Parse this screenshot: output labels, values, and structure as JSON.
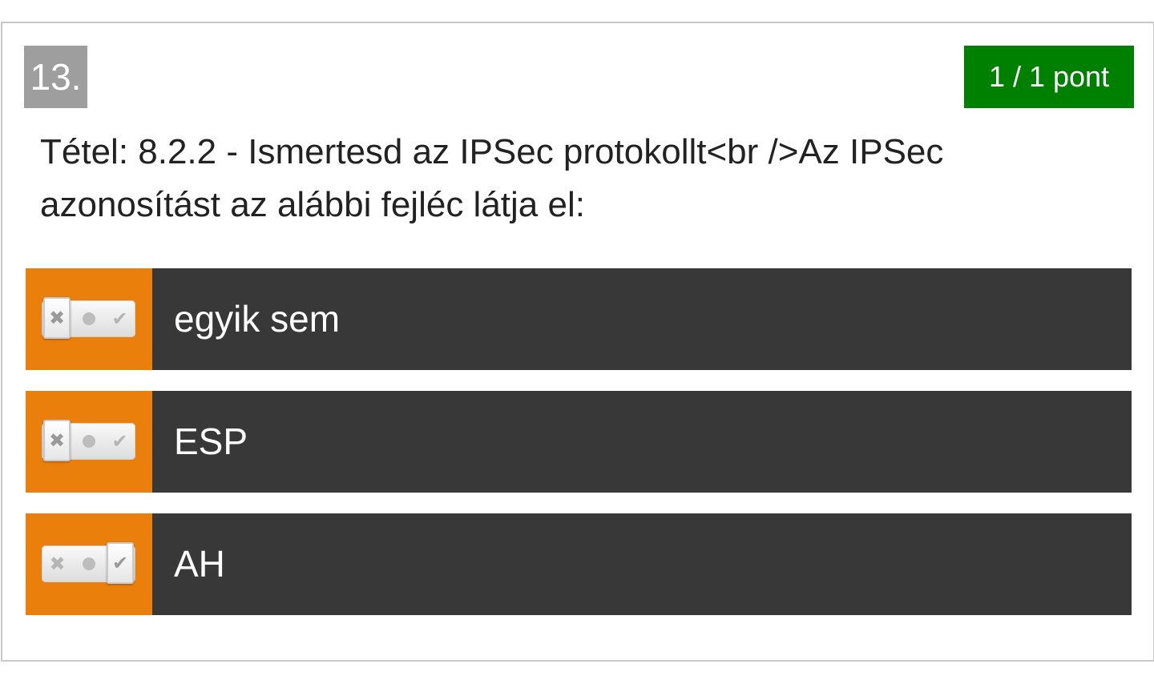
{
  "question": {
    "number": "13.",
    "score": "1 / 1 pont",
    "text": "Tétel: 8.2.2 - Ismertesd az IPSec protokollt<br />Az IPSec azonosítást az alábbi fejléc látja el:"
  },
  "answers": [
    {
      "label": "egyik sem",
      "state": "x"
    },
    {
      "label": "ESP",
      "state": "x"
    },
    {
      "label": "AH",
      "state": "check"
    }
  ],
  "colors": {
    "score_bg": "#008000",
    "number_bg": "#9e9e9e",
    "answer_handle": "#ea7f0c",
    "answer_bg": "#383838"
  },
  "icons": {
    "x": "x-mark-icon",
    "neutral": "dot-icon",
    "check": "check-mark-icon"
  }
}
